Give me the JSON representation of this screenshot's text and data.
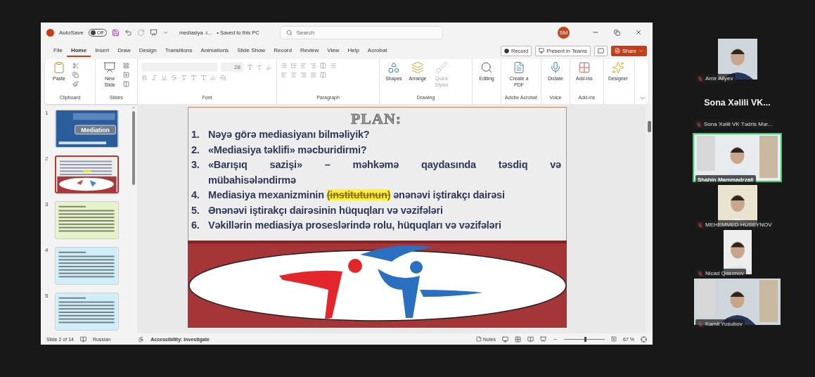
{
  "window": {
    "autosave_label": "AutoSave",
    "autosave": {
      "on": false,
      "label": "Off"
    },
    "title": "mediasiya -i...",
    "save_status": "• Saved to this PC",
    "search": {
      "placeholder": "Search"
    },
    "user_initials": "SM"
  },
  "menu_tabs": [
    {
      "label": "File",
      "selected": false
    },
    {
      "label": "Home",
      "selected": true
    },
    {
      "label": "Insert",
      "selected": false
    },
    {
      "label": "Draw",
      "selected": false
    },
    {
      "label": "Design",
      "selected": false
    },
    {
      "label": "Transitions",
      "selected": false
    },
    {
      "label": "Animations",
      "selected": false
    },
    {
      "label": "Slide Show",
      "selected": false
    },
    {
      "label": "Record",
      "selected": false
    },
    {
      "label": "Review",
      "selected": false
    },
    {
      "label": "View",
      "selected": false
    },
    {
      "label": "Help",
      "selected": false
    },
    {
      "label": "Acrobat",
      "selected": false
    }
  ],
  "header_buttons": [
    {
      "kind": "record",
      "label": "Record"
    },
    {
      "kind": "teams",
      "label": "Present in Teams"
    },
    {
      "kind": "comments"
    },
    {
      "kind": "share",
      "label": "Share"
    }
  ],
  "ribbon": {
    "groups": [
      {
        "label": "Clipboard",
        "buttons": [
          {
            "label": "Paste",
            "disabled": false
          }
        ]
      },
      {
        "label": "Slides",
        "buttons": [
          {
            "label": "New Slide",
            "disabled": false
          }
        ]
      },
      {
        "label": "Font",
        "font_size": "28"
      },
      {
        "label": "Paragraph"
      },
      {
        "label": "Drawing",
        "buttons": [
          {
            "label": "Shapes",
            "disabled": false
          },
          {
            "label": "Arrange",
            "disabled": false
          },
          {
            "label": "Quick Styles",
            "disabled": true
          }
        ]
      },
      {
        "buttons": [
          {
            "label": "Editing",
            "disabled": false
          }
        ]
      },
      {
        "label": "Adobe Acrobat",
        "buttons": [
          {
            "label": "Create a PDF",
            "disabled": false
          }
        ]
      },
      {
        "label": "Voice",
        "buttons": [
          {
            "label": "Dictate",
            "disabled": false
          }
        ]
      },
      {
        "label": "Add-ins",
        "buttons": [
          {
            "label": "Add-ins",
            "disabled": false
          }
        ]
      },
      {
        "buttons": [
          {
            "label": "Designer",
            "disabled": false
          }
        ]
      }
    ]
  },
  "thumbnails": [
    {
      "number": "1",
      "selected": false,
      "kind": "title",
      "caption": "Mediation"
    },
    {
      "number": "2",
      "selected": true,
      "kind": "plan"
    },
    {
      "number": "3",
      "selected": false,
      "kind": "text",
      "color": "#e6f3c8"
    },
    {
      "number": "4",
      "selected": false,
      "kind": "text",
      "color": "#cfeef8"
    },
    {
      "number": "5",
      "selected": false,
      "kind": "text",
      "color": "#cfeef8"
    }
  ],
  "slide": {
    "title": "PLAN:",
    "items": [
      {
        "number": "1.",
        "lines": [
          "Nəyə görə mediasiyanı bilməliyik?"
        ]
      },
      {
        "number": "2.",
        "lines": [
          "«Mediasiya təklifi» məcburidirmi?"
        ]
      },
      {
        "number": "3.",
        "lines": [
          "«Barışıq sazişi» – məhkəmə qaydasında təsdiq və",
          "mübahisələndirmə"
        ]
      },
      {
        "number": "4.",
        "lines": [
          "Mediasiya mexanizminin"
        ],
        "struck": "(institutunun)",
        "after": "ənənəvi iştirakçı dairəsi"
      },
      {
        "number": "5.",
        "lines": [
          "Ənənəvi iştirakçı dairəsinin hüquqları və vəzifələri"
        ]
      },
      {
        "number": "6.",
        "lines": [
          "Vəkillərin mediasiya proseslərində rolu, hüquqları və vəzifələri"
        ]
      }
    ]
  },
  "status_bar": {
    "slide_count": "Slide 2 of 14",
    "language": "Russian",
    "accessibility": "Accessibility: Investigate",
    "notes": "Notes",
    "zoom": {
      "level": 0.5,
      "label": "67 %"
    }
  },
  "participants": [
    {
      "kind": "narrow",
      "name": "Amir Aliyev",
      "muted": true,
      "speaking": false
    },
    {
      "kind": "no_video",
      "display": "Sona Xəlili VK...",
      "name": "Sona Xəlili VK Tədris Mər...",
      "muted": true,
      "speaking": false
    },
    {
      "kind": "wide",
      "name": "Shahin Mammadrzali",
      "muted": false,
      "speaking": true
    },
    {
      "kind": "narrow",
      "name": "MEHEMMED HUSEYNOV",
      "muted": true,
      "speaking": false
    },
    {
      "kind": "slim",
      "name": "Nicad Qasımov",
      "muted": true,
      "speaking": false
    },
    {
      "kind": "wide",
      "name": "Kamil Yusubov",
      "muted": true,
      "speaking": false
    }
  ]
}
